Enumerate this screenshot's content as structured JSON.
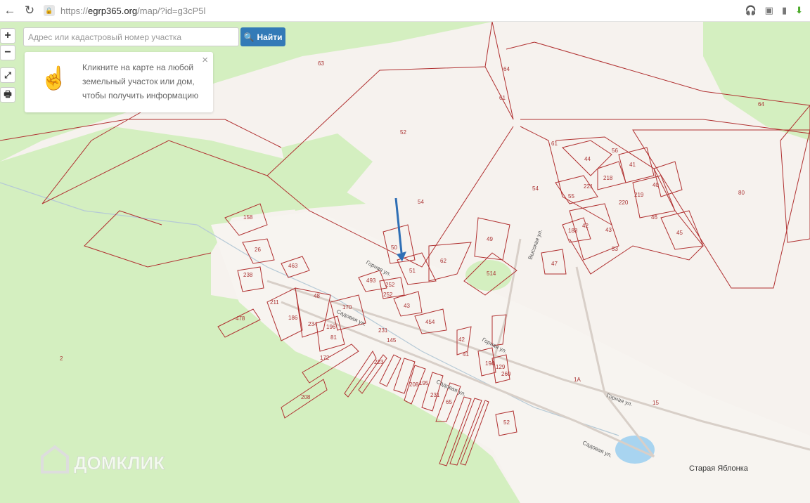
{
  "browser": {
    "url_prefix": "https://",
    "url_domain": "egrp365.org",
    "url_path": "/map/?id=g3cP5l",
    "back_icon": "arrow-left-icon",
    "reload_icon": "reload-icon",
    "lock_icon": "lock-icon",
    "extension_icons": [
      "headphones-icon",
      "extension-badge-icon",
      "bookmark-icon",
      "download-arrow-icon"
    ]
  },
  "map_controls": {
    "zoom_in": "+",
    "zoom_out": "−",
    "fullscreen_icon": "expand-icon",
    "print_icon": "printer-icon"
  },
  "search": {
    "placeholder": "Адрес или кадастровый номер участка",
    "value": "",
    "button_label": "Найти",
    "button_icon": "search-icon"
  },
  "info_panel": {
    "line1": "Кликните на карте на любой",
    "line2": "земельный участок или дом,",
    "line3": "чтобы получить информацию",
    "icon": "hand-pointer-icon",
    "close": "×"
  },
  "parcel_labels": [
    "63",
    "64",
    "61",
    "64",
    "52",
    "54",
    "61",
    "44",
    "56",
    "41",
    "218",
    "221",
    "55",
    "219",
    "40",
    "220",
    "46",
    "80",
    "158",
    "26",
    "50",
    "51",
    "49",
    "62",
    "514",
    "188",
    "42",
    "43",
    "53",
    "45",
    "47",
    "238",
    "463",
    "493",
    "252",
    "252",
    "43",
    "170",
    "48",
    "211",
    "186",
    "234",
    "196",
    "81",
    "478",
    "454",
    "42",
    "41",
    "231",
    "145",
    "172",
    "223",
    "194",
    "129",
    "260",
    "208",
    "195",
    "231",
    "65",
    "208",
    "52",
    "2",
    "1А",
    "15",
    "54"
  ],
  "streets": [
    "Горная ул.",
    "Горная ул.",
    "Горная ул.",
    "Садовая ул.",
    "Садовая ул.",
    "Садовая ул.",
    "Высокая ул."
  ],
  "place_name": "Старая Яблонка",
  "watermark": "ДОМКЛИК",
  "colors": {
    "forest": "#d4efc0",
    "parcel_border": "#b03030",
    "water": "#a8d4f0",
    "arrow": "#2f6fb5",
    "button": "#337ab7"
  }
}
